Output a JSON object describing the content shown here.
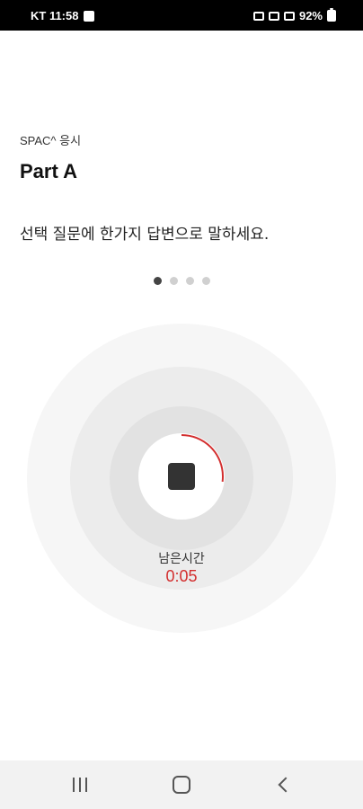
{
  "status_bar": {
    "carrier_time": "KT 11:58",
    "battery": "92%"
  },
  "header": {
    "subtitle": "SPAC^ 응시",
    "title": "Part A",
    "instruction": "선택 질문에 한가지 답변으로 말하세요."
  },
  "pagination": {
    "total": 4,
    "current": 1
  },
  "recorder": {
    "remaining_label": "남은시간",
    "remaining_time": "0:05",
    "progress_fraction": 0.27,
    "accent_color": "#d32f2f"
  },
  "nav_bar": {
    "recent_icon": "recent-apps-icon",
    "home_icon": "home-icon",
    "back_icon": "back-icon"
  }
}
